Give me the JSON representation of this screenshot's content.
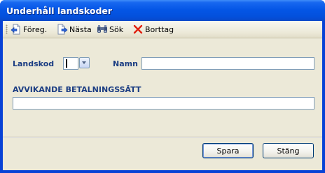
{
  "window": {
    "title": "Underhåll landskoder"
  },
  "toolbar": {
    "previous_label": "Föreg.",
    "next_label": "Nästa",
    "search_label": "Sök",
    "delete_label": "Borttag"
  },
  "form": {
    "landskod_label": "Landskod",
    "landskod_value": "",
    "namn_label": "Namn",
    "namn_value": "",
    "betalningssatt_label": "AVVIKANDE BETALNINGSSÄTT",
    "betalningssatt_value": ""
  },
  "buttons": {
    "save_label": "Spara",
    "close_label": "Stäng"
  },
  "colors": {
    "title_bar": "#0556e6",
    "label_text": "#1a3c82",
    "dialog_bg": "#ece9d8",
    "delete_icon": "#e02010"
  }
}
